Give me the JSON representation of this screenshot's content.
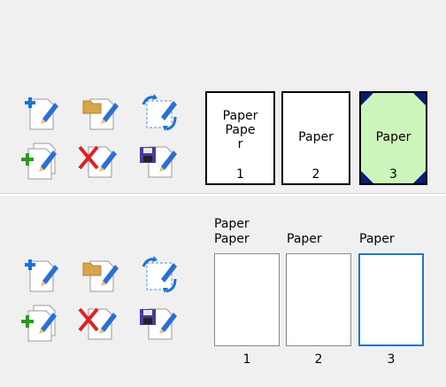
{
  "top": {
    "pages": [
      {
        "lines": [
          "Paper",
          "Pape",
          "r"
        ],
        "number": "1",
        "selected": false
      },
      {
        "lines": [
          "Paper"
        ],
        "number": "2",
        "selected": false
      },
      {
        "lines": [
          "Paper"
        ],
        "number": "3",
        "selected": true
      }
    ]
  },
  "bottom": {
    "pages": [
      {
        "lines": [
          "Paper",
          "Paper"
        ],
        "number": "1",
        "selected": false
      },
      {
        "lines": [
          "Paper"
        ],
        "number": "2",
        "selected": false
      },
      {
        "lines": [
          "Paper"
        ],
        "number": "3",
        "selected": true
      }
    ]
  },
  "tools": [
    {
      "icon": "new-document-icon"
    },
    {
      "icon": "open-folder-icon"
    },
    {
      "icon": "rotate-page-icon"
    },
    {
      "icon": "duplicate-document-icon"
    },
    {
      "icon": "delete-document-icon"
    },
    {
      "icon": "save-document-icon"
    }
  ],
  "colors": {
    "selected_fill": "#ccf5bb",
    "selected_border": "#1e78c8",
    "corner_mark": "#0a1a7a"
  }
}
